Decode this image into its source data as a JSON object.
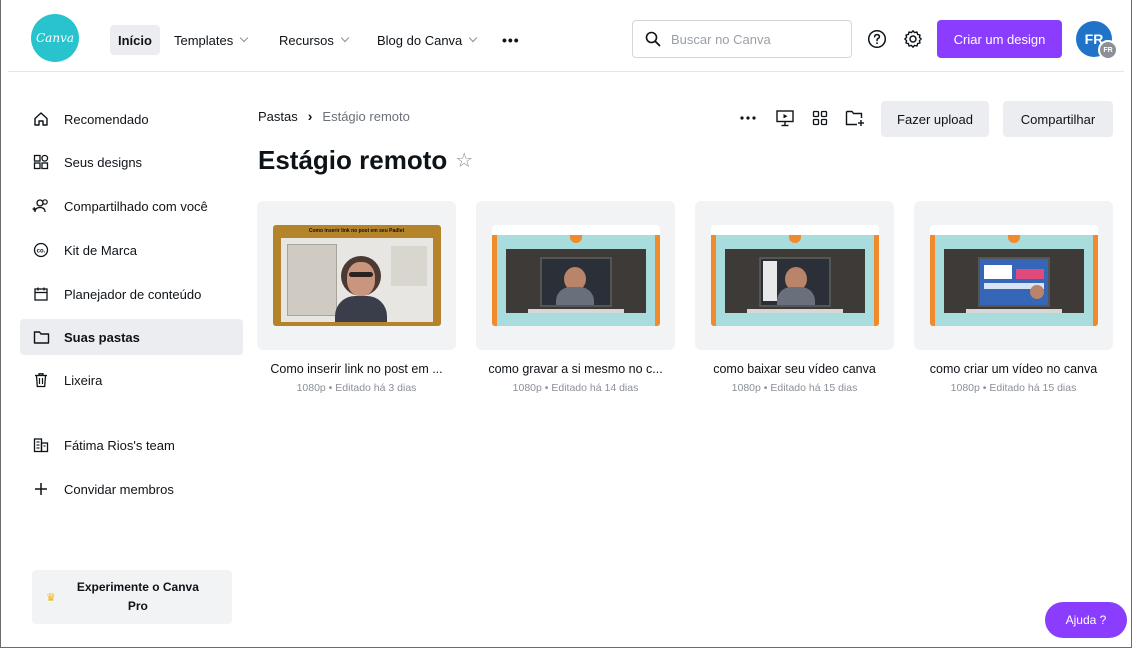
{
  "header": {
    "logo_text": "Canva",
    "nav": [
      {
        "label": "Início"
      },
      {
        "label": "Templates"
      },
      {
        "label": "Recursos"
      },
      {
        "label": "Blog do Canva"
      }
    ],
    "more_label": "•••",
    "search_placeholder": "Buscar no Canva",
    "create_label": "Criar um design",
    "avatar_initials": "FR",
    "avatar_badge": "FR",
    "accent_color": "#8b3dff"
  },
  "sidebar": {
    "items": [
      {
        "label": "Recomendado",
        "icon": "home-icon"
      },
      {
        "label": "Seus designs",
        "icon": "grid-icon"
      },
      {
        "label": "Compartilhado com você",
        "icon": "shared-users-icon"
      },
      {
        "label": "Kit de Marca",
        "icon": "brand-kit-icon"
      },
      {
        "label": "Planejador de conteúdo",
        "icon": "calendar-icon"
      },
      {
        "label": "Suas pastas",
        "icon": "folder-icon"
      },
      {
        "label": "Lixeira",
        "icon": "trash-icon"
      }
    ],
    "team_label": "Fátima Rios's team",
    "invite_label": "Convidar membros",
    "pro_label": "Experimente o Canva Pro"
  },
  "main": {
    "breadcrumb_root": "Pastas",
    "breadcrumb_sep": "›",
    "breadcrumb_current": "Estágio remoto",
    "title": "Estágio remoto",
    "star": "☆",
    "upload_label": "Fazer upload",
    "share_label": "Compartilhar",
    "cards": [
      {
        "name": "Como inserir link no post em ...",
        "meta": "1080p • Editado há 3 dias",
        "thumb_caption": "Como inserir link no post em seu Padlet"
      },
      {
        "name": "como gravar a si mesmo no c...",
        "meta": "1080p • Editado há 14 dias"
      },
      {
        "name": "como baixar seu vídeo canva",
        "meta": "1080p • Editado há 15 dias"
      },
      {
        "name": "como criar um vídeo no canva",
        "meta": "1080p • Editado há 15 dias"
      }
    ]
  },
  "help_label": "Ajuda ?"
}
